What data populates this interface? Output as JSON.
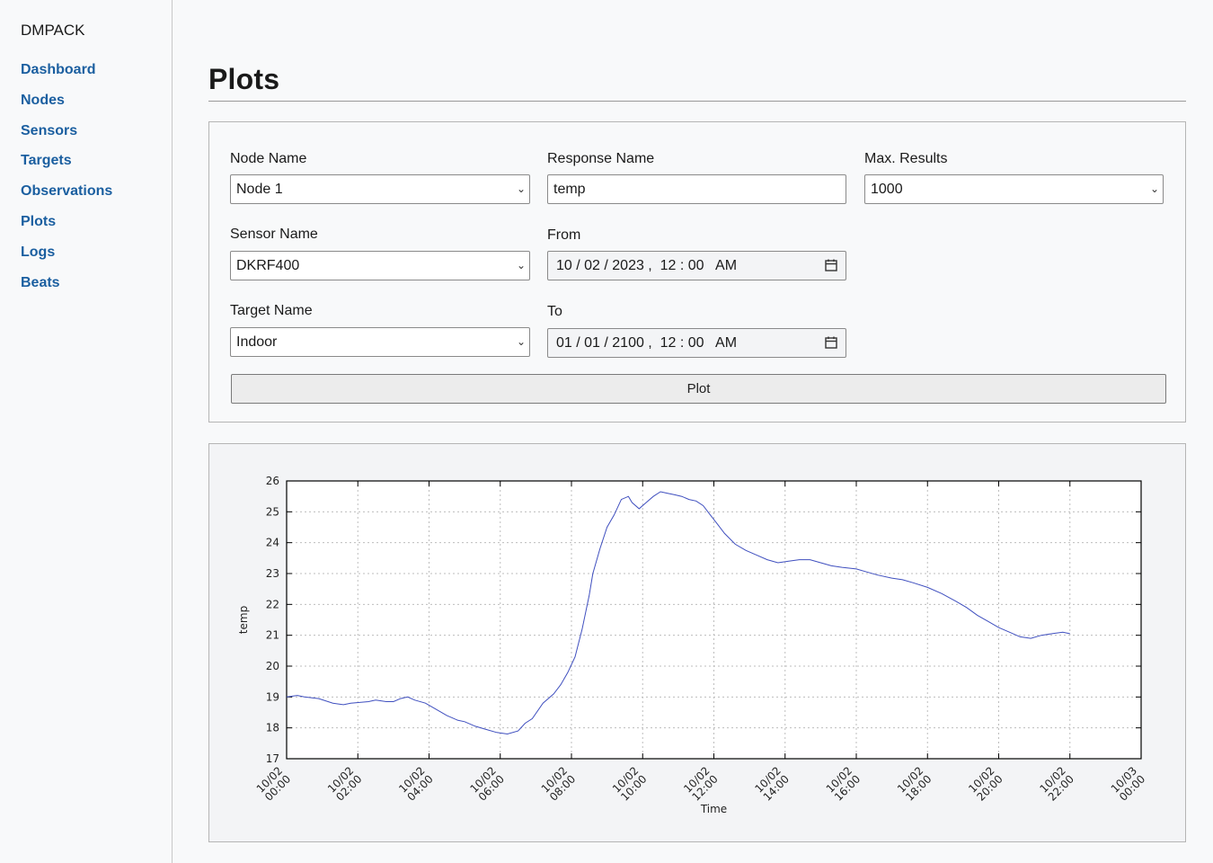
{
  "app": {
    "brand": "DMPACK"
  },
  "sidebar": {
    "items": [
      {
        "label": "Dashboard"
      },
      {
        "label": "Nodes"
      },
      {
        "label": "Sensors"
      },
      {
        "label": "Targets"
      },
      {
        "label": "Observations"
      },
      {
        "label": "Plots"
      },
      {
        "label": "Logs"
      },
      {
        "label": "Beats"
      }
    ]
  },
  "page": {
    "title": "Plots"
  },
  "form": {
    "node_label": "Node Name",
    "node_value": "Node 1",
    "response_label": "Response Name",
    "response_value": "temp",
    "max_label": "Max. Results",
    "max_value": "1000",
    "sensor_label": "Sensor Name",
    "sensor_value": "DKRF400",
    "from_label": "From",
    "from_value": "10 / 02 / 2023 ,  12 : 00   AM",
    "target_label": "Target Name",
    "target_value": "Indoor",
    "to_label": "To",
    "to_value": "01 / 01 / 2100 ,  12 : 00   AM",
    "plot_button": "Plot"
  },
  "chart_data": {
    "type": "line",
    "xlabel": "Time",
    "ylabel": "temp",
    "ylim": [
      17,
      26
    ],
    "xlim_hours": [
      0,
      24
    ],
    "y_ticks": [
      17,
      18,
      19,
      20,
      21,
      22,
      23,
      24,
      25,
      26
    ],
    "x_ticks": [
      {
        "date": "10/02",
        "time": "00:00"
      },
      {
        "date": "10/02",
        "time": "02:00"
      },
      {
        "date": "10/02",
        "time": "04:00"
      },
      {
        "date": "10/02",
        "time": "06:00"
      },
      {
        "date": "10/02",
        "time": "08:00"
      },
      {
        "date": "10/02",
        "time": "10:00"
      },
      {
        "date": "10/02",
        "time": "12:00"
      },
      {
        "date": "10/02",
        "time": "14:00"
      },
      {
        "date": "10/02",
        "time": "16:00"
      },
      {
        "date": "10/02",
        "time": "18:00"
      },
      {
        "date": "10/02",
        "time": "20:00"
      },
      {
        "date": "10/02",
        "time": "22:00"
      },
      {
        "date": "10/03",
        "time": "00:00"
      }
    ],
    "grid": true,
    "line_color": "#3f4fbf",
    "series": [
      {
        "x": [
          0,
          0.3,
          0.5,
          0.9,
          1.3,
          1.6,
          1.8,
          2.3,
          2.5,
          2.8,
          3.0,
          3.2,
          3.4,
          3.6,
          3.9,
          4.2,
          4.5,
          4.8,
          5.0,
          5.3,
          5.6,
          5.9,
          6.2,
          6.5,
          6.7,
          6.9,
          7.2,
          7.5,
          7.7,
          7.9,
          8.1,
          8.3,
          8.5,
          8.6,
          8.8,
          9.0,
          9.2,
          9.4,
          9.6,
          9.7,
          9.9,
          10.1,
          10.3,
          10.5,
          10.7,
          10.9,
          11.1,
          11.3,
          11.5,
          11.7,
          11.9,
          12.1,
          12.3,
          12.6,
          12.9,
          13.2,
          13.5,
          13.8,
          14.1,
          14.4,
          14.7,
          15.0,
          15.3,
          15.6,
          16.0,
          16.3,
          16.6,
          17.0,
          17.3,
          17.6,
          18.0,
          18.4,
          18.8,
          19.1,
          19.4,
          19.7,
          20.0,
          20.3,
          20.6,
          20.9,
          21.2,
          21.5,
          21.8,
          22.0
        ],
        "y": [
          19.0,
          19.05,
          19.0,
          18.95,
          18.8,
          18.75,
          18.8,
          18.85,
          18.9,
          18.85,
          18.85,
          18.95,
          19.0,
          18.9,
          18.8,
          18.6,
          18.4,
          18.25,
          18.2,
          18.05,
          17.95,
          17.85,
          17.8,
          17.9,
          18.15,
          18.3,
          18.8,
          19.1,
          19.4,
          19.8,
          20.3,
          21.2,
          22.3,
          23.0,
          23.8,
          24.5,
          24.9,
          25.4,
          25.5,
          25.3,
          25.1,
          25.3,
          25.5,
          25.65,
          25.6,
          25.55,
          25.5,
          25.4,
          25.35,
          25.2,
          24.9,
          24.6,
          24.3,
          23.95,
          23.75,
          23.6,
          23.45,
          23.35,
          23.4,
          23.45,
          23.45,
          23.35,
          23.25,
          23.2,
          23.15,
          23.05,
          22.95,
          22.85,
          22.8,
          22.7,
          22.55,
          22.35,
          22.1,
          21.9,
          21.65,
          21.45,
          21.25,
          21.1,
          20.95,
          20.9,
          21.0,
          21.05,
          21.1,
          21.05
        ]
      }
    ]
  }
}
